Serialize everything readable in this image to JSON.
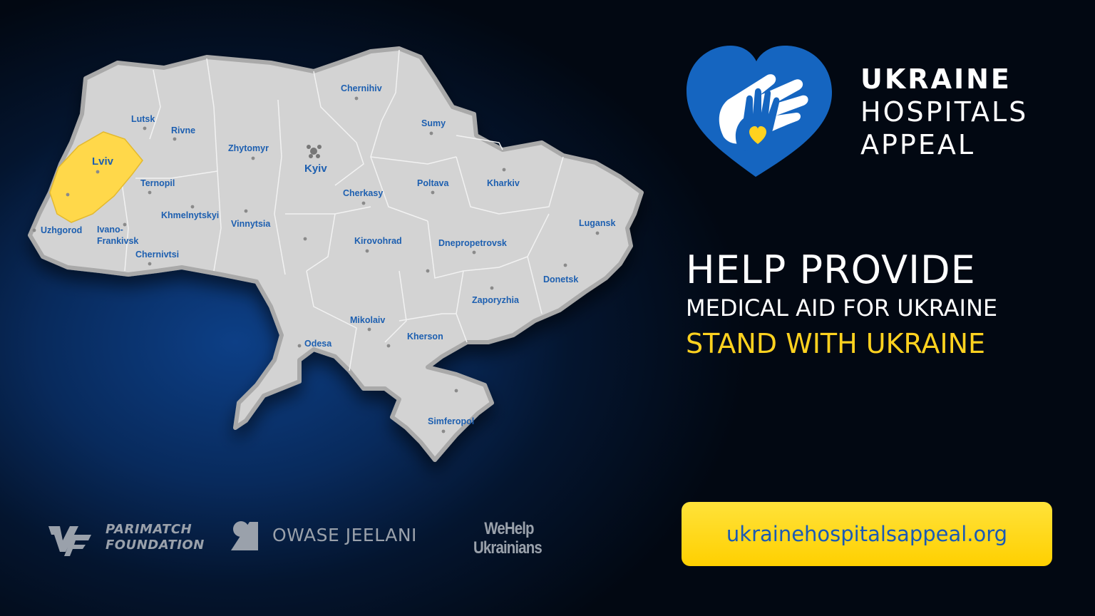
{
  "brand": {
    "line1": "UKRAINE",
    "line2": "HOSPITALS",
    "line3": "APPEAL",
    "heart_color": "#1565c0",
    "accent_color": "#ffd21f"
  },
  "headline": {
    "line1": "HELP PROVIDE",
    "line2": "MEDICAL AID FOR UKRAINE",
    "line3": "STAND WITH UKRAINE"
  },
  "website": {
    "url": "ukrainehospitalsappeal.org"
  },
  "map": {
    "highlighted_region": "Lviv",
    "highlight_color": "#ffd84a",
    "cities": {
      "lutsk": "Lutsk",
      "rivne": "Rivne",
      "lviv": "Lviv",
      "ternopil": "Ternopil",
      "uzhgorod": "Uzhgorod",
      "ivano1": "Ivano-",
      "ivano2": "Frankivsk",
      "chernivtsi": "Chernivtsi",
      "khmelnytskyi": "Khmelnytskyi",
      "zhytomyr": "Zhytomyr",
      "vinnytsia": "Vinnytsia",
      "kyiv": "Kyiv",
      "chernihiv": "Chernihiv",
      "sumy": "Sumy",
      "poltava": "Poltava",
      "kharkiv": "Kharkiv",
      "cherkasy": "Cherkasy",
      "kirovohrad": "Kirovohrad",
      "dnepropetrovsk": "Dnepropetrovsk",
      "lugansk": "Lugansk",
      "donetsk": "Donetsk",
      "zaporyzhia": "Zaporyzhia",
      "mikolaiv": "Mikolaiv",
      "kherson": "Kherson",
      "odesa": "Odesa",
      "simferopol": "Simferopol"
    }
  },
  "partners": {
    "parimatch_1": "PARIMATCH",
    "parimatch_2": "FOUNDATION",
    "owase": "OWASE JEELANI",
    "wehelp_1": "WeHelp",
    "wehelp_2": "Ukrainians"
  }
}
